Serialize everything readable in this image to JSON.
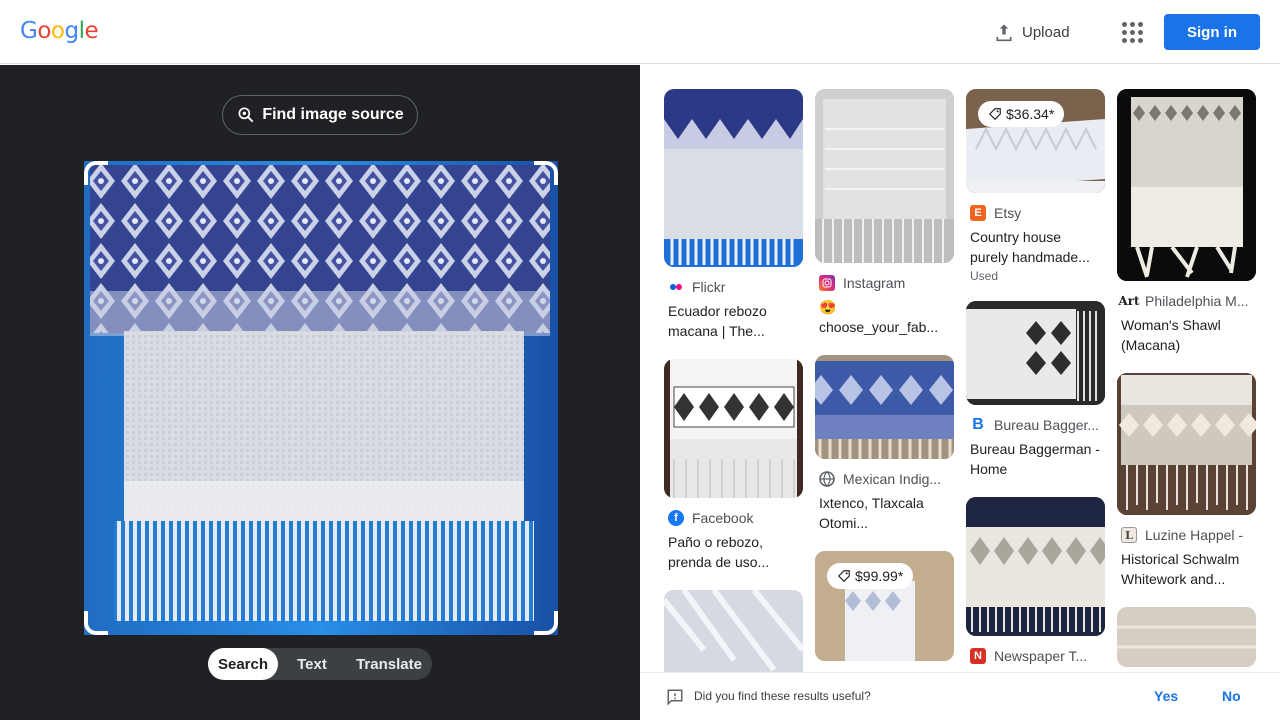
{
  "header": {
    "logo_letters": [
      {
        "ch": "G",
        "color": "#4285f4"
      },
      {
        "ch": "o",
        "color": "#ea4335"
      },
      {
        "ch": "o",
        "color": "#fbbc05"
      },
      {
        "ch": "g",
        "color": "#4285f4"
      },
      {
        "ch": "l",
        "color": "#34a853"
      },
      {
        "ch": "e",
        "color": "#ea4335"
      }
    ],
    "upload_label": "Upload",
    "signin_label": "Sign in"
  },
  "left_panel": {
    "find_source_label": "Find image source",
    "modes": [
      "Search",
      "Text",
      "Translate"
    ],
    "active_mode": "Search"
  },
  "results": {
    "col1": [
      {
        "source": "Flickr",
        "icon": "flickr-icon",
        "title": "Ecuador rebozo macana | The..."
      },
      {
        "source": "Facebook",
        "icon": "facebook-icon",
        "title": "Paño o rebozo, prenda de uso..."
      },
      {
        "source": "",
        "icon": "",
        "title": ""
      }
    ],
    "col2": [
      {
        "source": "Instagram",
        "icon": "instagram-icon",
        "emoji": "😍",
        "title": "choose_your_fab..."
      },
      {
        "source": "Mexican Indig...",
        "icon": "globe-icon",
        "title": "Ixtenco, Tlaxcala Otomi..."
      },
      {
        "price": "$99.99*",
        "source": "",
        "title": ""
      }
    ],
    "col3": [
      {
        "price": "$36.34*",
        "source": "Etsy",
        "icon": "etsy-icon",
        "title": "Country house purely handmade...",
        "sub": "Used"
      },
      {
        "source": "Bureau Bagger...",
        "icon": "bureau-icon",
        "title": "Bureau Baggerman - Home"
      },
      {
        "source": "Newspaper T...",
        "icon": "site-icon",
        "title": ""
      }
    ],
    "col4": [
      {
        "source": "Philadelphia M...",
        "icon": "philadelphia-art-icon",
        "title": "Woman's Shawl (Macana)"
      },
      {
        "source": "Luzine Happel -",
        "icon": "luzine-icon",
        "title": "Historical Schwalm Whitework and..."
      },
      {
        "source": "",
        "icon": "",
        "title": ""
      }
    ]
  },
  "feedback": {
    "question": "Did you find these results useful?",
    "yes": "Yes",
    "no": "No"
  },
  "colors": {
    "accent": "#1a73e8",
    "dark_panel": "#202124"
  }
}
